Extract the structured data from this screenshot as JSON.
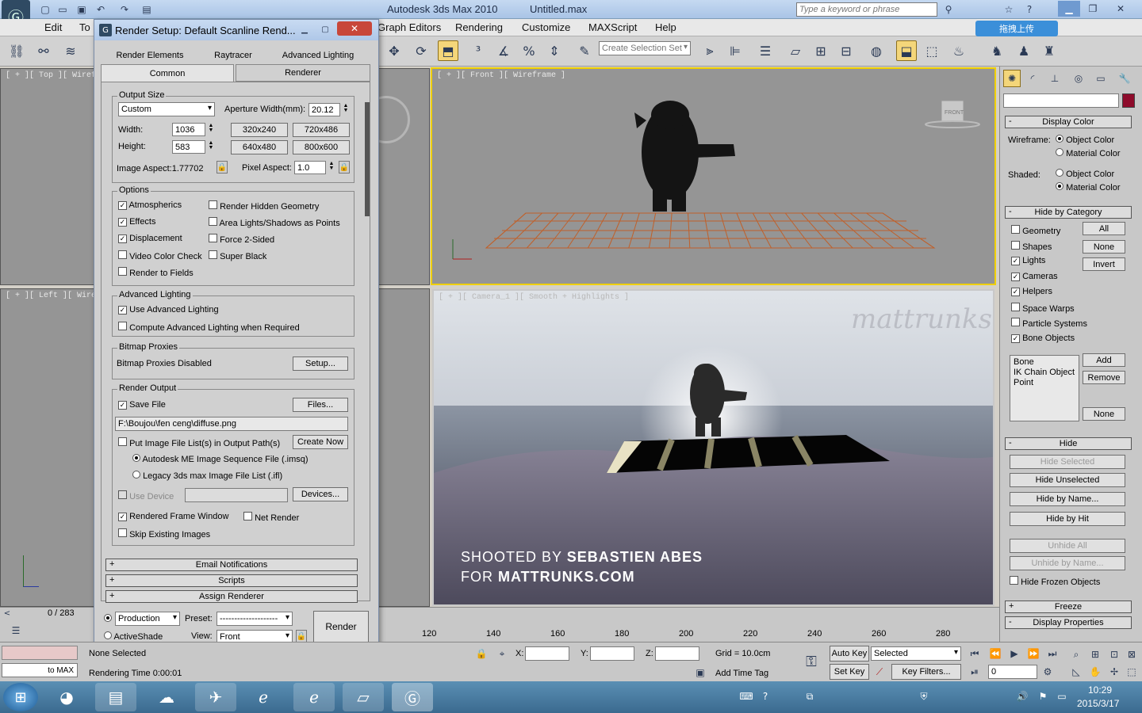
{
  "app": {
    "title": "Autodesk 3ds Max  2010",
    "file": "Untitled.max",
    "search_placeholder": "Type a keyword or phrase"
  },
  "menu": [
    "Edit",
    "To",
    "Graph Editors",
    "Rendering",
    "Customize",
    "MAXScript",
    "Help"
  ],
  "toolbar": {
    "selection_set_placeholder": "Create Selection Set"
  },
  "upload_button": "拖拽上传",
  "viewports": {
    "top": "[ + ][ Top ][ Wirefra",
    "left": "[ + ][ Left ][ Wirefra",
    "front": "[ + ][ Front ][ Wireframe ]",
    "camera": "[ + ][ Camera_1 ][ Smooth + Highlights ]",
    "viewcube_front": "FRONT",
    "watermark": "mattrunks",
    "credit_line1_prefix": "SHOOTED BY ",
    "credit_line1_name": "SEBASTIEN ABES",
    "credit_line2_prefix": "FOR ",
    "credit_line2_site": "MATTRUNKS.COM"
  },
  "dialog": {
    "title": "Render Setup: Default Scanline Rend...",
    "tabs_row1": [
      "Render Elements",
      "Raytracer",
      "Advanced Lighting"
    ],
    "tabs_row2": [
      "Common",
      "Renderer"
    ],
    "output_size": {
      "title": "Output Size",
      "preset": "Custom",
      "aperture_label": "Aperture Width(mm):",
      "aperture": "20.12",
      "width_label": "Width:",
      "width": "1036",
      "height_label": "Height:",
      "height": "583",
      "presets": [
        "320x240",
        "720x486",
        "640x480",
        "800x600"
      ],
      "image_aspect": "Image Aspect:1.77702",
      "pixel_aspect_label": "Pixel Aspect:",
      "pixel_aspect": "1.0"
    },
    "options": {
      "title": "Options",
      "left": [
        {
          "label": "Atmospherics",
          "checked": true
        },
        {
          "label": "Effects",
          "checked": true
        },
        {
          "label": "Displacement",
          "checked": true
        },
        {
          "label": "Video Color Check",
          "checked": false
        },
        {
          "label": "Render to Fields",
          "checked": false
        }
      ],
      "right": [
        {
          "label": "Render Hidden Geometry",
          "checked": false
        },
        {
          "label": "Area Lights/Shadows as Points",
          "checked": false
        },
        {
          "label": "Force 2-Sided",
          "checked": false
        },
        {
          "label": "Super Black",
          "checked": false
        }
      ]
    },
    "adv_lighting": {
      "title": "Advanced Lighting",
      "use": "Use Advanced Lighting",
      "compute": "Compute Advanced Lighting when Required"
    },
    "bitmap": {
      "title": "Bitmap Proxies",
      "status": "Bitmap Proxies Disabled",
      "setup": "Setup..."
    },
    "render_output": {
      "title": "Render Output",
      "save_file": "Save File",
      "files": "Files...",
      "path": "F:\\Boujou\\fen ceng\\diffuse.png",
      "put_list": "Put Image File List(s) in Output Path(s)",
      "create_now": "Create Now",
      "autodesk": "Autodesk ME Image Sequence File (.imsq)",
      "legacy": "Legacy 3ds max Image File List (.ifl)",
      "use_device": "Use Device",
      "devices": "Devices...",
      "rendered_frame": "Rendered Frame Window",
      "net_render": "Net Render",
      "skip": "Skip Existing Images"
    },
    "rollouts": [
      "Email Notifications",
      "Scripts",
      "Assign Renderer"
    ],
    "bottom": {
      "production": "Production",
      "activeshade": "ActiveShade",
      "preset_label": "Preset:",
      "preset": "--------------------",
      "view_label": "View:",
      "view": "Front",
      "render": "Render"
    }
  },
  "command_panel": {
    "display_color": "Display Color",
    "wireframe_label": "Wireframe:",
    "shaded_label": "Shaded:",
    "object_color": "Object Color",
    "material_color": "Material Color",
    "hide_by_category": "Hide by Category",
    "categories": [
      {
        "label": "Geometry",
        "checked": false
      },
      {
        "label": "Shapes",
        "checked": false
      },
      {
        "label": "Lights",
        "checked": true
      },
      {
        "label": "Cameras",
        "checked": true
      },
      {
        "label": "Helpers",
        "checked": true
      },
      {
        "label": "Space Warps",
        "checked": false
      },
      {
        "label": "Particle Systems",
        "checked": false
      },
      {
        "label": "Bone Objects",
        "checked": true
      }
    ],
    "cat_buttons": [
      "All",
      "None",
      "Invert"
    ],
    "list_items": [
      "Bone",
      "IK Chain Object",
      "Point"
    ],
    "list_buttons": [
      "Add",
      "Remove",
      "None"
    ],
    "hide": "Hide",
    "hide_buttons": [
      {
        "label": "Hide Selected",
        "disabled": true
      },
      {
        "label": "Hide Unselected",
        "disabled": false
      },
      {
        "label": "Hide by Name...",
        "disabled": false
      },
      {
        "label": "Hide by Hit",
        "disabled": false
      },
      {
        "label": "Unhide All",
        "disabled": true
      },
      {
        "label": "Unhide by Name...",
        "disabled": true
      }
    ],
    "hide_frozen": "Hide Frozen Objects",
    "freeze": "Freeze",
    "display_props": "Display Properties"
  },
  "timeline": {
    "frame": "0 / 283",
    "ticks": [
      "120",
      "140",
      "160",
      "180",
      "200",
      "220",
      "240",
      "260",
      "280"
    ]
  },
  "status": {
    "none_selected": "None Selected",
    "welcome": "to MAX",
    "rendering_time": "Rendering Time  0:00:01",
    "x": "X:",
    "y": "Y:",
    "z": "Z:",
    "grid": "Grid = 10.0cm",
    "add_time_tag": "Add Time Tag",
    "auto_key": "Auto Key",
    "set_key": "Set Key",
    "selected": "Selected",
    "key_filters": "Key Filters...",
    "frame_value": "0"
  },
  "clock": {
    "time": "10:29",
    "date": "2015/3/17"
  },
  "colors": {
    "accent_yellow": "#f0d000",
    "swatch": "#8e0b2b",
    "grid_orange": "#c0602a"
  }
}
